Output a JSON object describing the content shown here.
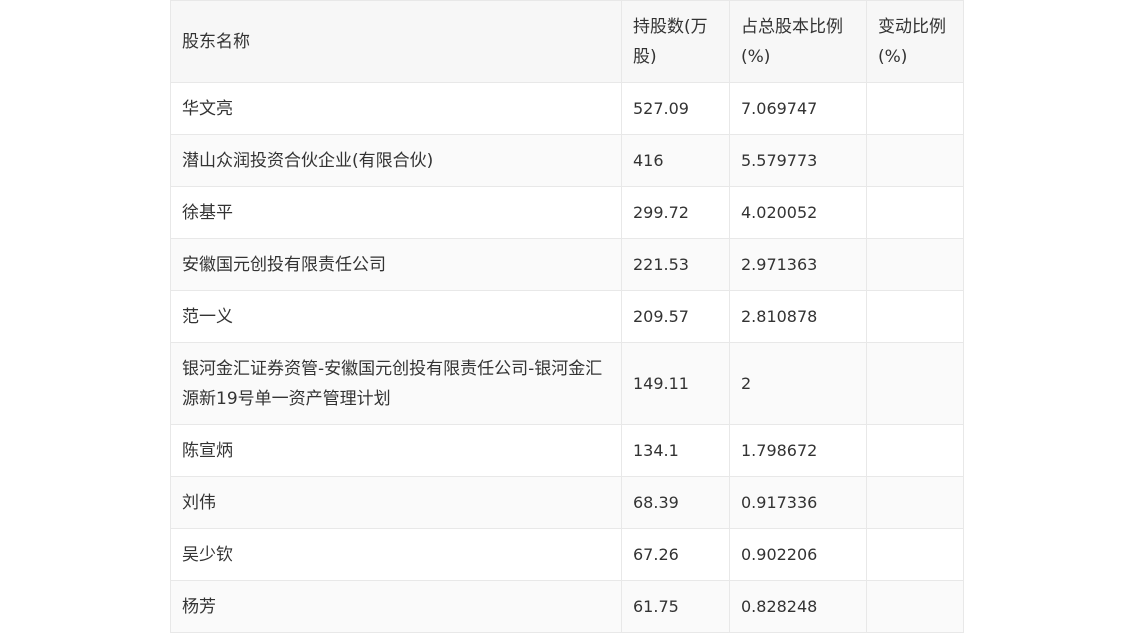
{
  "table": {
    "headers": [
      "股东名称",
      "持股数(万股)",
      "占总股本比例(%)",
      "变动比例(%)"
    ],
    "rows": [
      {
        "name": "华文亮",
        "shares": "527.09",
        "ratio": "7.069747",
        "change": ""
      },
      {
        "name": "潜山众润投资合伙企业(有限合伙)",
        "shares": "416",
        "ratio": "5.579773",
        "change": ""
      },
      {
        "name": "徐基平",
        "shares": "299.72",
        "ratio": "4.020052",
        "change": ""
      },
      {
        "name": "安徽国元创投有限责任公司",
        "shares": "221.53",
        "ratio": "2.971363",
        "change": ""
      },
      {
        "name": "范一义",
        "shares": "209.57",
        "ratio": "2.810878",
        "change": ""
      },
      {
        "name": "银河金汇证券资管-安徽国元创投有限责任公司-银河金汇源新19号单一资产管理计划",
        "shares": "149.11",
        "ratio": "2",
        "change": ""
      },
      {
        "name": "陈宣炳",
        "shares": "134.1",
        "ratio": "1.798672",
        "change": ""
      },
      {
        "name": "刘伟",
        "shares": "68.39",
        "ratio": "0.917336",
        "change": ""
      },
      {
        "name": "吴少钦",
        "shares": "67.26",
        "ratio": "0.902206",
        "change": ""
      },
      {
        "name": "杨芳",
        "shares": "61.75",
        "ratio": "0.828248",
        "change": ""
      }
    ]
  }
}
